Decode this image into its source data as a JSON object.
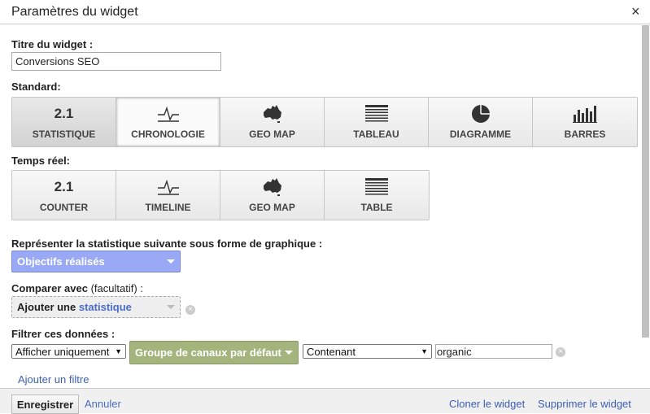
{
  "dialog": {
    "title": "Paramètres du widget",
    "close": "×"
  },
  "widget_title": {
    "label": "Titre du widget :",
    "value": "Conversions SEO"
  },
  "standard": {
    "label": "Standard:",
    "items": [
      {
        "icon": "2.1",
        "label": "STATISTIQUE",
        "icon_name": "number-icon"
      },
      {
        "icon": "",
        "label": "CHRONOLOGIE",
        "icon_name": "timeline-icon"
      },
      {
        "icon": "",
        "label": "GEO MAP",
        "icon_name": "australia-map-icon"
      },
      {
        "icon": "",
        "label": "TABLEAU",
        "icon_name": "table-icon"
      },
      {
        "icon": "",
        "label": "DIAGRAMME",
        "icon_name": "pie-chart-icon"
      },
      {
        "icon": "",
        "label": "BARRES",
        "icon_name": "bar-chart-icon"
      }
    ]
  },
  "realtime": {
    "label": "Temps réel:",
    "items": [
      {
        "icon": "2.1",
        "label": "COUNTER",
        "icon_name": "number-icon"
      },
      {
        "icon": "",
        "label": "TIMELINE",
        "icon_name": "timeline-icon"
      },
      {
        "icon": "",
        "label": "GEO MAP",
        "icon_name": "australia-map-icon"
      },
      {
        "icon": "",
        "label": "TABLE",
        "icon_name": "table-icon"
      }
    ]
  },
  "metric": {
    "label": "Représenter la statistique suivante sous forme de graphique :",
    "value": "Objectifs réalisés",
    "color": "#9aa9f5"
  },
  "compare": {
    "label": "Comparer avec",
    "optional": "(facultatif) :",
    "prefix": "Ajouter une",
    "link": "statistique"
  },
  "filter": {
    "label": "Filtrer ces données :",
    "mode": "Afficher uniquement",
    "dimension": "Groupe de canaux par défaut",
    "dimension_color": "#a3b47c",
    "operator": "Contenant",
    "value": "organic",
    "add": "Ajouter un filtre"
  },
  "footer": {
    "save": "Enregistrer",
    "cancel": "Annuler",
    "clone": "Cloner le widget",
    "delete": "Supprimer le widget"
  }
}
